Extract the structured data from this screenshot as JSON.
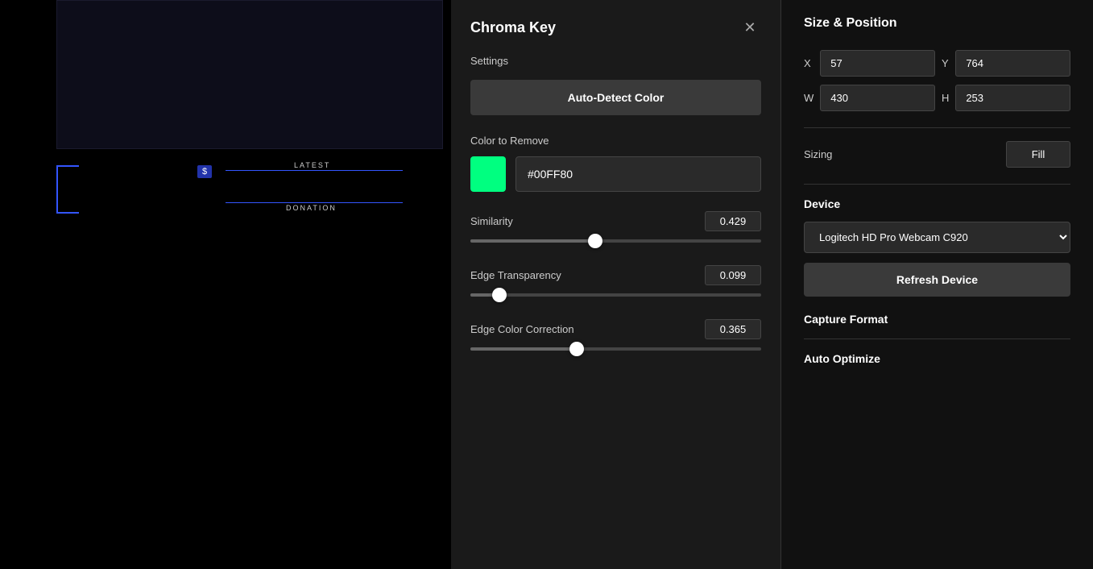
{
  "left": {
    "widget_latest": "LATEST",
    "widget_donation": "DONATION",
    "widget_dollar": "$"
  },
  "chroma_key": {
    "title": "Chroma Key",
    "close_label": "✕",
    "settings_label": "Settings",
    "auto_detect_label": "Auto-Detect Color",
    "color_to_remove_label": "Color to Remove",
    "color_hex_value": "#00FF80",
    "color_hex_placeholder": "#00FF80",
    "similarity_label": "Similarity",
    "similarity_value": "0.429",
    "similarity_pct": 42.9,
    "edge_transparency_label": "Edge Transparency",
    "edge_transparency_value": "0.099",
    "edge_transparency_pct": 9.9,
    "edge_color_correction_label": "Edge Color Correction",
    "edge_color_correction_value": "0.365",
    "edge_color_correction_pct": 36.5
  },
  "size_position": {
    "title": "Size & Position",
    "x_label": "X",
    "x_value": "57",
    "y_label": "Y",
    "y_value": "764",
    "w_label": "W",
    "w_value": "430",
    "h_label": "H",
    "h_value": "253",
    "sizing_label": "Sizing",
    "sizing_value": "Fill",
    "device_title": "Device",
    "device_name": "Logitech HD Pro Webcam C920",
    "refresh_label": "Refresh Device",
    "capture_format_title": "Capture Format",
    "auto_optimize_title": "Auto Optimize"
  },
  "colors": {
    "green": "#00FF80",
    "accent_blue": "#3355ff",
    "bg_dark": "#111111",
    "bg_mid": "#1a1a1a",
    "panel_bg": "#2a2a2a"
  }
}
